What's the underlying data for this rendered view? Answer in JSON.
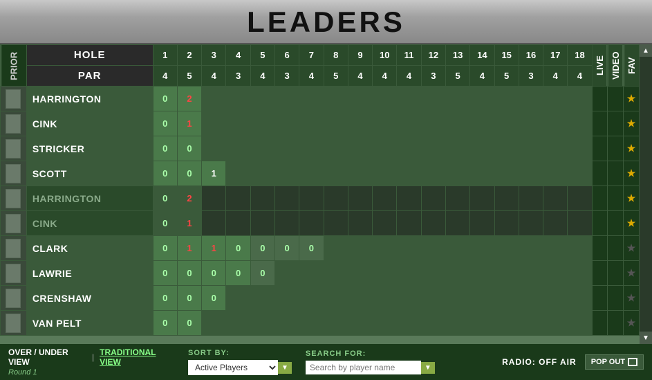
{
  "header": {
    "title": "LEADERS"
  },
  "columns": {
    "prior": "PRIOR",
    "hole": "HOLE",
    "par": "PAR",
    "holes": [
      1,
      2,
      3,
      4,
      5,
      6,
      7,
      8,
      9,
      10,
      11,
      12,
      13,
      14,
      15,
      16,
      17,
      18
    ],
    "pars": [
      4,
      5,
      4,
      3,
      4,
      3,
      4,
      5,
      4,
      4,
      4,
      3,
      5,
      4,
      5,
      3,
      4,
      4
    ],
    "live": "LIVE",
    "video": "VIDEO",
    "fav": "FAV"
  },
  "players": [
    {
      "name": "HARRINGTON",
      "faded": false,
      "scores": [
        "0",
        "2",
        "",
        "",
        "",
        "",
        "",
        "",
        "",
        "",
        "",
        "",
        "",
        "",
        "",
        "",
        "",
        "",
        "",
        ""
      ],
      "scoreColors": [
        "green",
        "red",
        "",
        "",
        "",
        "",
        "",
        "",
        "",
        "",
        "",
        "",
        "",
        "",
        "",
        "",
        "",
        "",
        "",
        ""
      ],
      "star": "gold"
    },
    {
      "name": "CINK",
      "faded": false,
      "scores": [
        "0",
        "1",
        "",
        "",
        "",
        "",
        "",
        "",
        "",
        "",
        "",
        "",
        "",
        "",
        "",
        "",
        "",
        "",
        "",
        ""
      ],
      "scoreColors": [
        "green",
        "red",
        "",
        "",
        "",
        "",
        "",
        "",
        "",
        "",
        "",
        "",
        "",
        "",
        "",
        "",
        "",
        "",
        "",
        ""
      ],
      "star": "gold"
    },
    {
      "name": "STRICKER",
      "faded": false,
      "scores": [
        "0",
        "0",
        "",
        "",
        "",
        "",
        "",
        "",
        "",
        "",
        "",
        "",
        "",
        "",
        "",
        "",
        "",
        "",
        "",
        ""
      ],
      "scoreColors": [
        "green",
        "green",
        "",
        "",
        "",
        "",
        "",
        "",
        "",
        "",
        "",
        "",
        "",
        "",
        "",
        "",
        "",
        "",
        "",
        ""
      ],
      "star": "gold"
    },
    {
      "name": "SCOTT",
      "faded": false,
      "scores": [
        "0",
        "0",
        "1",
        "",
        "",
        "",
        "",
        "",
        "",
        "",
        "",
        "",
        "",
        "",
        "",
        "",
        "",
        "",
        "",
        ""
      ],
      "scoreColors": [
        "green",
        "green",
        "white",
        "",
        "",
        "",
        "",
        "",
        "",
        "",
        "",
        "",
        "",
        "",
        "",
        "",
        "",
        "",
        "",
        ""
      ],
      "star": "gold"
    },
    {
      "name": "HARRINGTON",
      "faded": true,
      "scores": [
        "0",
        "2",
        "",
        "",
        "",
        "",
        "",
        "",
        "",
        "",
        "",
        "",
        "",
        "",
        "",
        "",
        "",
        "",
        "",
        ""
      ],
      "scoreColors": [
        "green",
        "red",
        "",
        "",
        "",
        "",
        "",
        "",
        "",
        "",
        "",
        "",
        "",
        "",
        "",
        "",
        "",
        "",
        "",
        ""
      ],
      "star": "gold"
    },
    {
      "name": "CINK",
      "faded": true,
      "scores": [
        "0",
        "1",
        "",
        "",
        "",
        "",
        "",
        "",
        "",
        "",
        "",
        "",
        "",
        "",
        "",
        "",
        "",
        "",
        "",
        ""
      ],
      "scoreColors": [
        "green",
        "red",
        "",
        "",
        "",
        "",
        "",
        "",
        "",
        "",
        "",
        "",
        "",
        "",
        "",
        "",
        "",
        "",
        "",
        ""
      ],
      "star": "gold"
    },
    {
      "name": "CLARK",
      "faded": false,
      "scores": [
        "0",
        "1",
        "1",
        "0",
        "0",
        "0",
        "0",
        "",
        "",
        "",
        "",
        "",
        "",
        "",
        "",
        "",
        "",
        "",
        "",
        ""
      ],
      "scoreColors": [
        "green",
        "red",
        "red",
        "green",
        "green",
        "green",
        "green",
        "",
        "",
        "",
        "",
        "",
        "",
        "",
        "",
        "",
        "",
        "",
        "",
        ""
      ],
      "star": "grey"
    },
    {
      "name": "LAWRIE",
      "faded": false,
      "scores": [
        "0",
        "0",
        "0",
        "0",
        "0",
        "",
        "",
        "",
        "",
        "",
        "",
        "",
        "",
        "",
        "",
        "",
        "",
        "",
        "",
        ""
      ],
      "scoreColors": [
        "green",
        "green",
        "green",
        "green",
        "green",
        "",
        "",
        "",
        "",
        "",
        "",
        "",
        "",
        "",
        "",
        "",
        "",
        "",
        "",
        ""
      ],
      "star": "grey"
    },
    {
      "name": "CRENSHAW",
      "faded": false,
      "scores": [
        "0",
        "0",
        "0",
        "",
        "",
        "",
        "",
        "",
        "",
        "",
        "",
        "",
        "",
        "",
        "",
        "",
        "",
        "",
        "",
        ""
      ],
      "scoreColors": [
        "green",
        "green",
        "green",
        "",
        "",
        "",
        "",
        "",
        "",
        "",
        "",
        "",
        "",
        "",
        "",
        "",
        "",
        "",
        "",
        ""
      ],
      "star": "grey"
    },
    {
      "name": "VAN PELT",
      "faded": false,
      "scores": [
        "0",
        "0",
        "",
        "",
        "",
        "",
        "",
        "",
        "",
        "",
        "",
        "",
        "",
        "",
        "",
        "",
        "",
        "",
        "",
        ""
      ],
      "scoreColors": [
        "green",
        "green",
        "",
        "",
        "",
        "",
        "",
        "",
        "",
        "",
        "",
        "",
        "",
        "",
        "",
        "",
        "",
        "",
        "",
        ""
      ],
      "star": "grey"
    }
  ],
  "bottom": {
    "over_under_view": "OVER / UNDER VIEW",
    "separator": "|",
    "traditional_view": "TRADITIONAL VIEW",
    "round_label": "Round 1",
    "sort_by_label": "SORT BY:",
    "sort_by_value": "Active Players",
    "search_for_label": "SEARCH FOR:",
    "search_placeholder": "Search by player name",
    "radio_label": "RADIO: OFF AIR",
    "pop_out": "POP OUT"
  }
}
